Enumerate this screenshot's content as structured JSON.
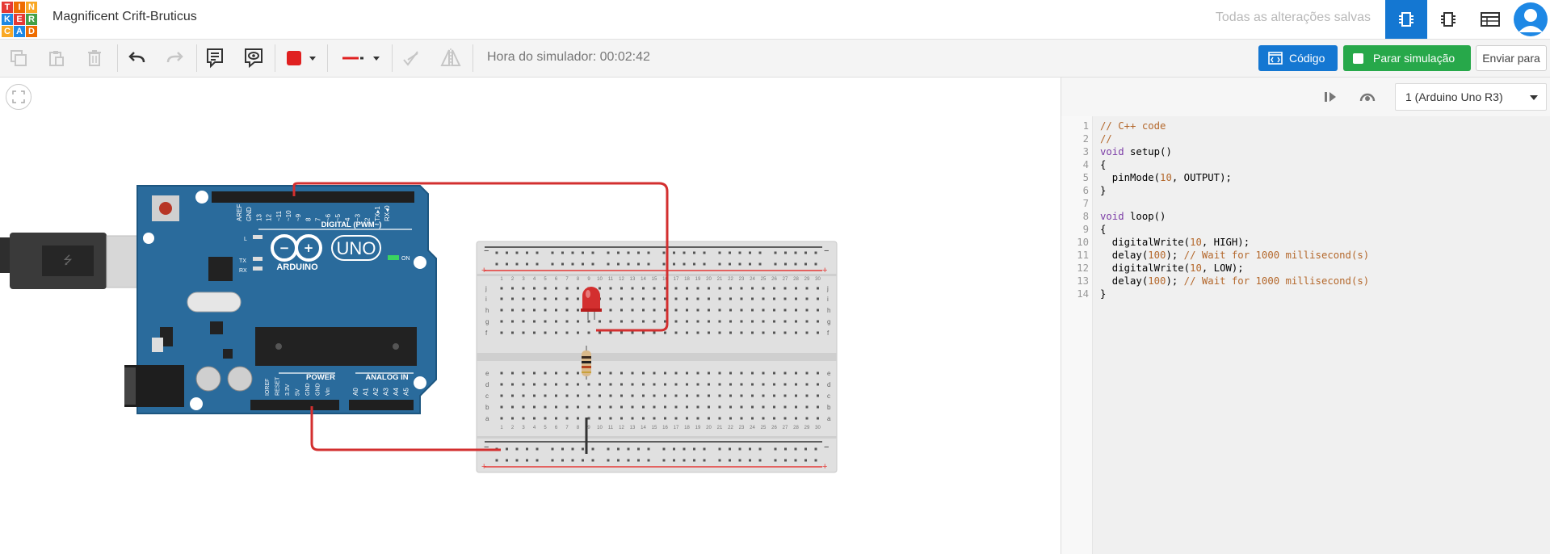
{
  "app": {
    "logo_letters": [
      "T",
      "I",
      "N",
      "K",
      "E",
      "R",
      "C",
      "A",
      "D"
    ],
    "logo_colors": [
      "#e53935",
      "#ef6c00",
      "#f9a825",
      "#1e88e5",
      "#e53935",
      "#43a047",
      "#f9a825",
      "#1e88e5",
      "#ef6c00"
    ],
    "project_title": "Magnificent Crift-Bruticus",
    "save_status": "Todas as alterações salvas"
  },
  "toolbar": {
    "simulator_time": "Hora do simulador: 00:02:42",
    "code_button": "Código",
    "stop_button": "Parar simulação",
    "send_button": "Enviar para",
    "wire_color": "#e02020"
  },
  "code_panel": {
    "device": "1 (Arduino Uno R3)",
    "lines": [
      {
        "n": "1",
        "tokens": [
          [
            "c",
            "// C++ code"
          ]
        ]
      },
      {
        "n": "2",
        "tokens": [
          [
            "c",
            "//"
          ]
        ]
      },
      {
        "n": "3",
        "tokens": [
          [
            "k",
            "void"
          ],
          [
            "t",
            " setup()"
          ]
        ]
      },
      {
        "n": "4",
        "tokens": [
          [
            "t",
            "{"
          ]
        ]
      },
      {
        "n": "5",
        "tokens": [
          [
            "t",
            "  pinMode("
          ],
          [
            "n",
            "10"
          ],
          [
            "t",
            ", OUTPUT);"
          ]
        ]
      },
      {
        "n": "6",
        "tokens": [
          [
            "t",
            "}"
          ]
        ]
      },
      {
        "n": "7",
        "tokens": [
          [
            "t",
            ""
          ]
        ]
      },
      {
        "n": "8",
        "tokens": [
          [
            "k",
            "void"
          ],
          [
            "t",
            " loop()"
          ]
        ]
      },
      {
        "n": "9",
        "tokens": [
          [
            "t",
            "{"
          ]
        ]
      },
      {
        "n": "10",
        "tokens": [
          [
            "t",
            "  digitalWrite("
          ],
          [
            "n",
            "10"
          ],
          [
            "t",
            ", HIGH);"
          ]
        ]
      },
      {
        "n": "11",
        "tokens": [
          [
            "t",
            "  delay("
          ],
          [
            "n",
            "100"
          ],
          [
            "t",
            "); "
          ],
          [
            "c",
            "// Wait for 1000 millisecond(s)"
          ]
        ]
      },
      {
        "n": "12",
        "tokens": [
          [
            "t",
            "  digitalWrite("
          ],
          [
            "n",
            "10"
          ],
          [
            "t",
            ", LOW);"
          ]
        ]
      },
      {
        "n": "13",
        "tokens": [
          [
            "t",
            "  delay("
          ],
          [
            "n",
            "100"
          ],
          [
            "t",
            "); "
          ],
          [
            "c",
            "// Wait for 1000 millisecond(s)"
          ]
        ]
      },
      {
        "n": "14",
        "tokens": [
          [
            "t",
            "}"
          ]
        ]
      }
    ]
  },
  "arduino": {
    "brand": "ARDUINO",
    "model": "UNO",
    "digital_label": "DIGITAL (PWM~)",
    "power_label": "POWER",
    "analog_label": "ANALOG IN",
    "on_label": "ON",
    "l_label": "L",
    "tx_label": "TX",
    "rx_label": "RX",
    "digital_pins": [
      "AREF",
      "GND",
      "13",
      "12",
      "~11",
      "~10",
      "~9",
      "8",
      "7",
      "~6",
      "~5",
      "4",
      "~3",
      "2",
      "TX▸1",
      "RX◂0"
    ],
    "power_pins": [
      "IOREF",
      "RESET",
      "3.3V",
      "5V",
      "GND",
      "GND",
      "Vin"
    ],
    "analog_pins": [
      "A0",
      "A1",
      "A2",
      "A3",
      "A4",
      "A5"
    ],
    "board_color": "#2a6b9c"
  },
  "breadboard": {
    "plus": "+",
    "minus": "−",
    "row_letters_top": [
      "j",
      "i",
      "h",
      "g",
      "f"
    ],
    "row_letters_bottom": [
      "e",
      "d",
      "c",
      "b",
      "a"
    ],
    "column_count": 30
  },
  "components": {
    "led_color": "#d32f2f"
  }
}
